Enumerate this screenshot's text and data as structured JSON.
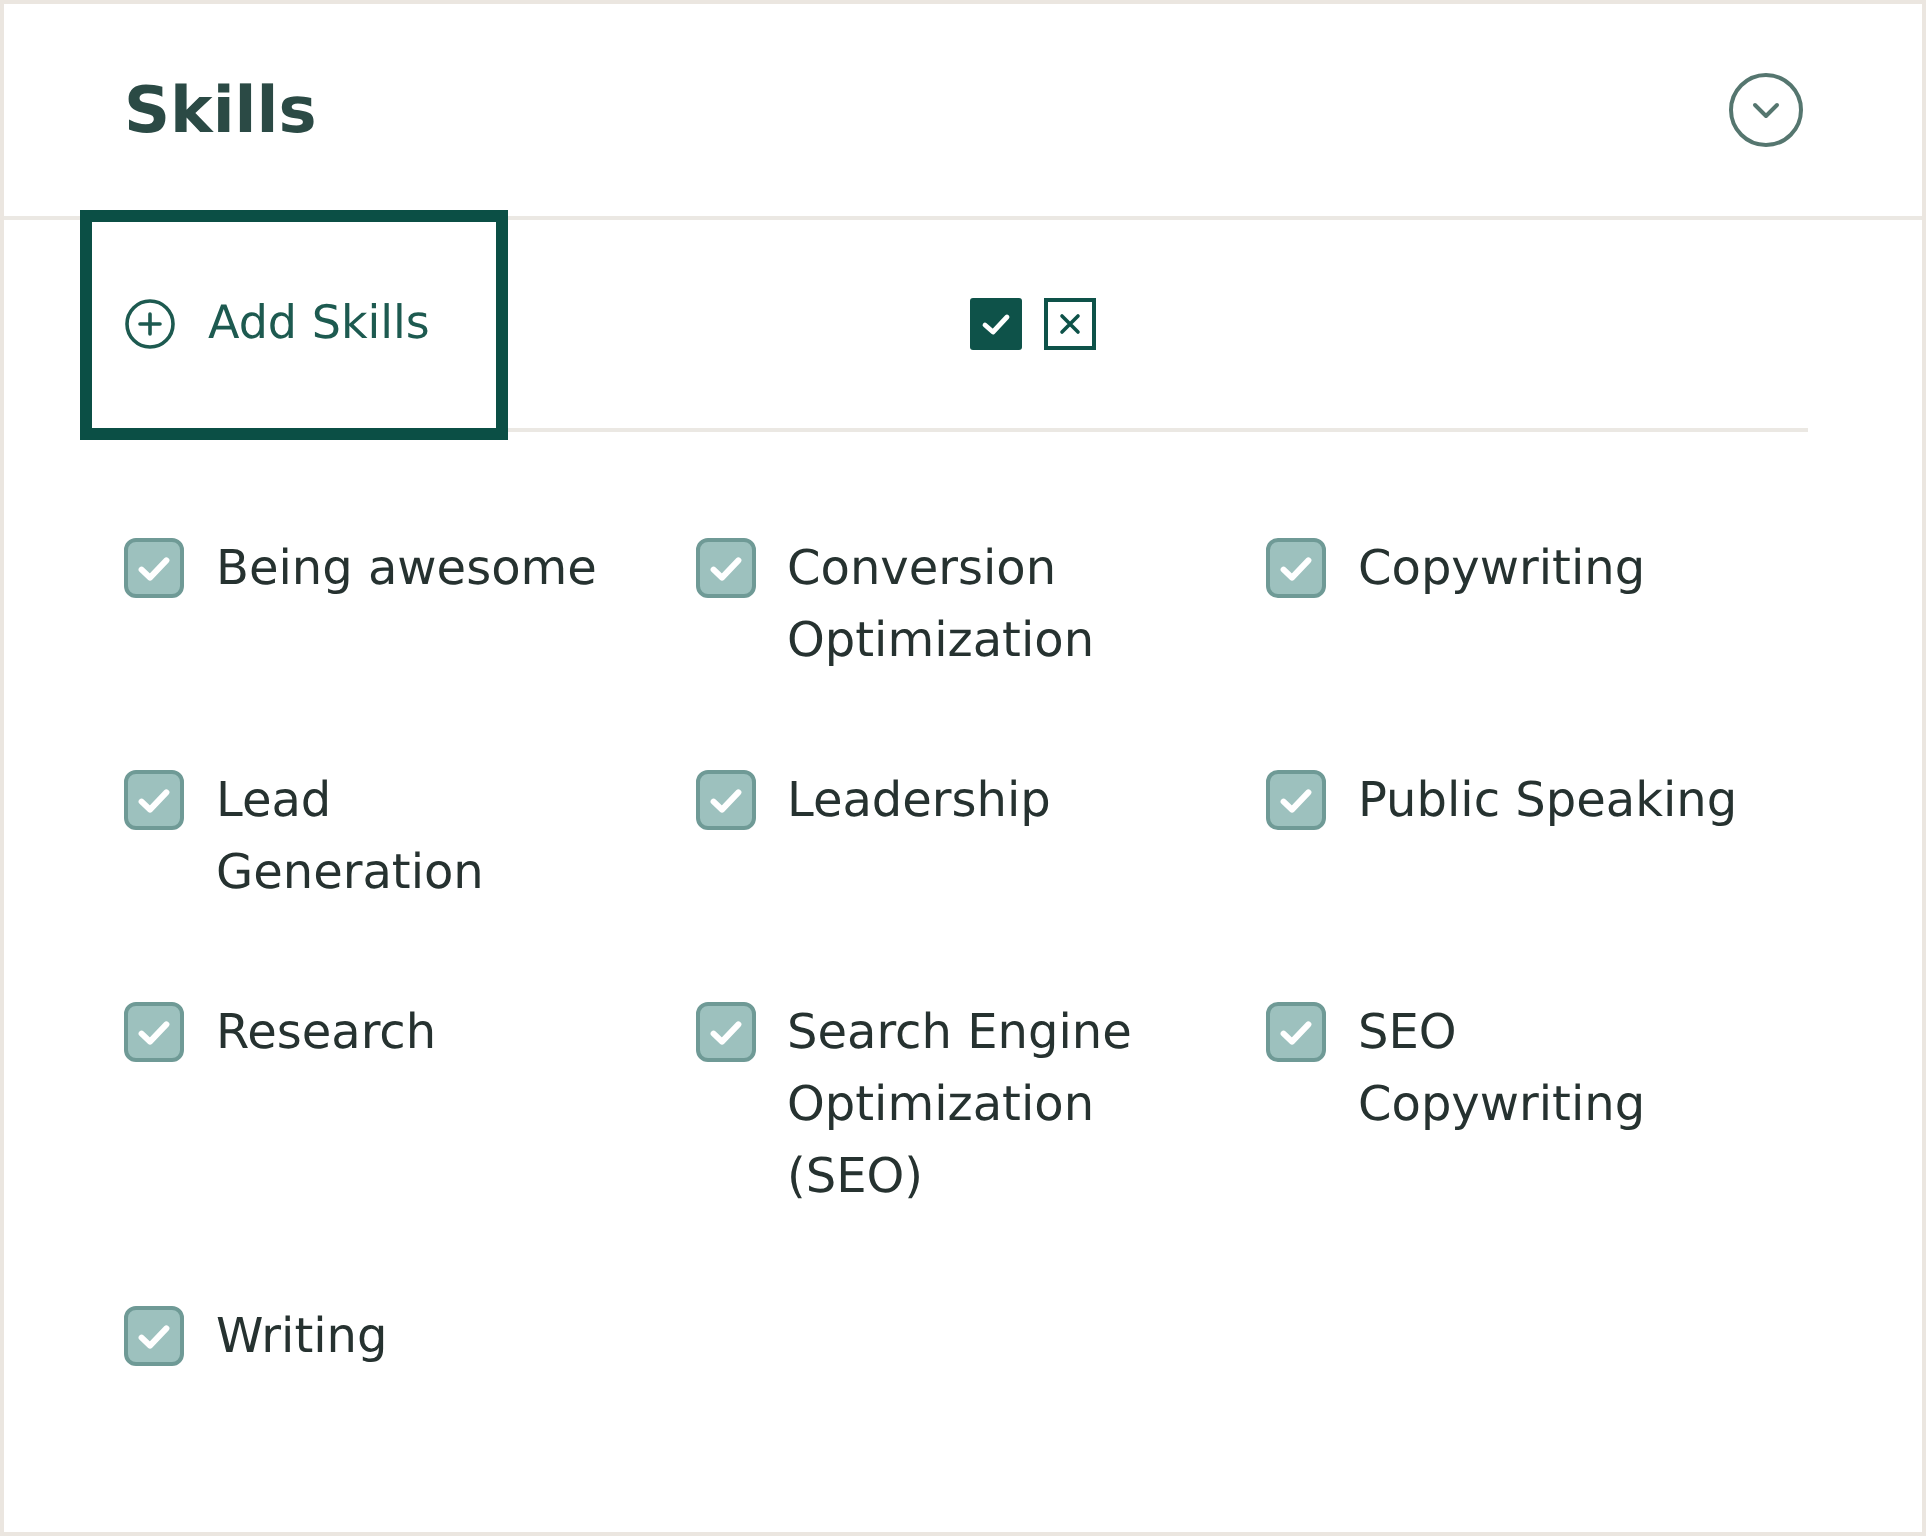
{
  "panel": {
    "title": "Skills",
    "expanded": true
  },
  "add_skills": {
    "label": "Add Skills",
    "highlighted": true
  },
  "skills": [
    {
      "label": "Being awesome",
      "checked": true
    },
    {
      "label": "Conversion Optimization",
      "checked": true
    },
    {
      "label": "Copywriting",
      "checked": true
    },
    {
      "label": "Lead Generation",
      "checked": true
    },
    {
      "label": "Leadership",
      "checked": true
    },
    {
      "label": "Public Speaking",
      "checked": true
    },
    {
      "label": "Research",
      "checked": true
    },
    {
      "label": "Search Engine Optimization (SEO)",
      "checked": true
    },
    {
      "label": "SEO Copywriting",
      "checked": true
    },
    {
      "label": "Writing",
      "checked": true
    }
  ]
}
